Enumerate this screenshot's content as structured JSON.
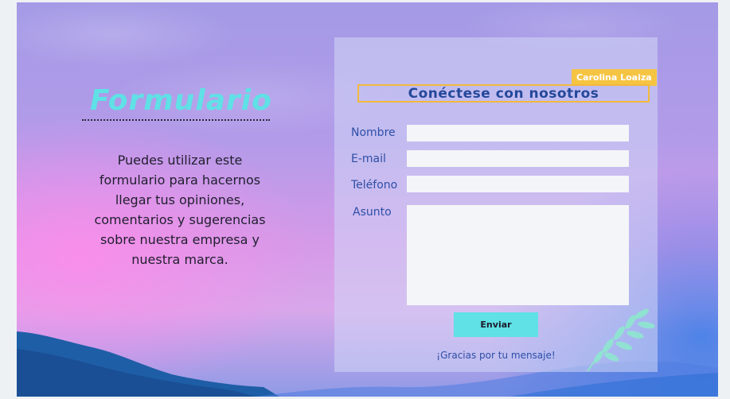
{
  "page": {
    "title": "Formulario",
    "description": "Puedes utilizar este formulario para hacernos llegar tus opiniones, comentarios y sugerencias sobre nuestra empresa y nuestra marca."
  },
  "form": {
    "author_badge": "Carolina Loaiza",
    "heading": "Conéctese con nosotros",
    "fields": [
      {
        "label": "Nombre",
        "value": "",
        "placeholder": ""
      },
      {
        "label": "E-mail",
        "value": "",
        "placeholder": ""
      },
      {
        "label": "Teléfono",
        "value": "",
        "placeholder": ""
      },
      {
        "label": "Asunto",
        "value": "",
        "placeholder": ""
      }
    ],
    "submit_label": "Enviar",
    "thanks_message": "¡Gracias por tu mensaje!"
  },
  "colors": {
    "accent_cyan": "#5fe1e6",
    "accent_yellow": "#f6c443",
    "heading_blue": "#24489a",
    "label_blue": "#2e4fa6"
  },
  "icons": {
    "decoration": "leaf-branch-icon"
  }
}
